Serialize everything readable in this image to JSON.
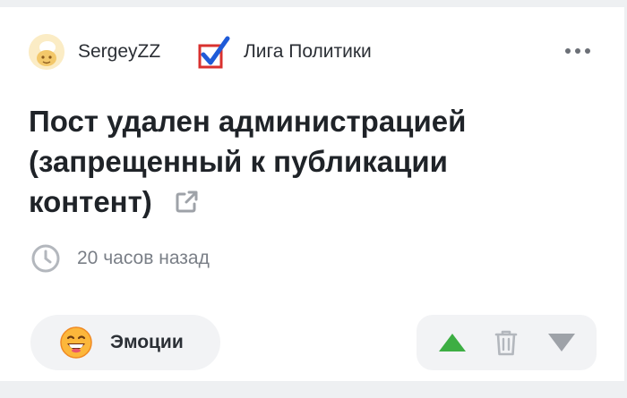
{
  "post": {
    "author": "SergeyZZ",
    "community": "Лига Политики",
    "title": "Пост удален администрацией (запрещенный к публикации контент)",
    "time": "20 часов назад"
  },
  "actions": {
    "emotions_label": "Эмоции"
  },
  "icons": {
    "avatar": "avatar-image",
    "community_logo": "checkmark-ballot-icon",
    "more": "more-dots-icon",
    "share": "external-link-icon",
    "clock": "clock-icon",
    "emotions": "smiling-face-emoji",
    "upvote": "triangle-up-icon",
    "delete": "trash-icon",
    "downvote": "triangle-down-icon"
  },
  "colors": {
    "upvote": "#3dae43",
    "downvote": "#9ea2a8",
    "muted_icon": "#b3b7bd",
    "button_bg": "#f2f3f5",
    "ballot_blue": "#1f5bd8",
    "ballot_red": "#d9312f"
  }
}
